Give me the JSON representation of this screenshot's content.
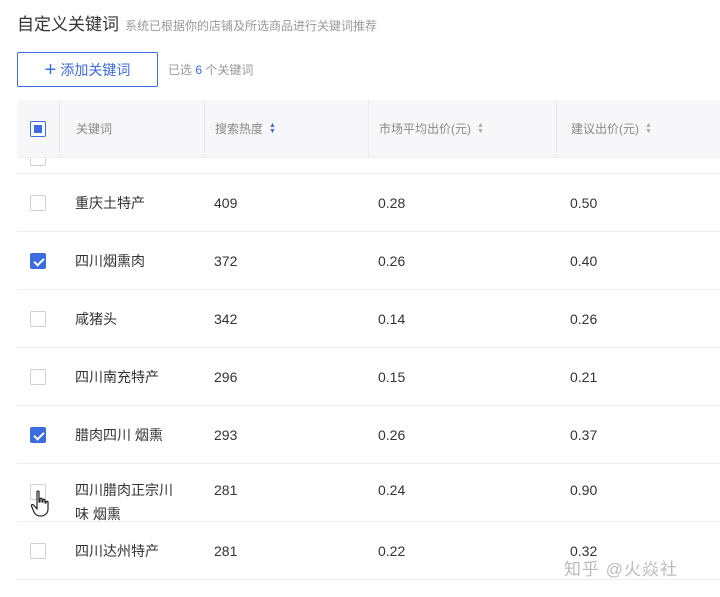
{
  "header": {
    "title": "自定义关键词",
    "subtitle": "系统已根据你的店铺及所选商品进行关键词推荐"
  },
  "toolbar": {
    "add_label": "添加关键词",
    "selected_prefix": "已选",
    "selected_count": "6",
    "selected_suffix": "个关键词"
  },
  "table": {
    "columns": {
      "keyword": "关键词",
      "heat": "搜索热度",
      "market_bid": "市场平均出价(元)",
      "suggest_bid": "建议出价(元)"
    },
    "rows": [
      {
        "keyword": "重庆土特产",
        "heat": "409",
        "market_bid": "0.28",
        "suggest_bid": "0.50",
        "checked": false
      },
      {
        "keyword": "四川烟熏肉",
        "heat": "372",
        "market_bid": "0.26",
        "suggest_bid": "0.40",
        "checked": true
      },
      {
        "keyword": "咸猪头",
        "heat": "342",
        "market_bid": "0.14",
        "suggest_bid": "0.26",
        "checked": false
      },
      {
        "keyword": "四川南充特产",
        "heat": "296",
        "market_bid": "0.15",
        "suggest_bid": "0.21",
        "checked": false
      },
      {
        "keyword": "腊肉四川 烟熏",
        "heat": "293",
        "market_bid": "0.26",
        "suggest_bid": "0.37",
        "checked": true
      },
      {
        "keyword_line1": "四川腊肉正宗川",
        "keyword_line2": "味 烟熏",
        "heat": "281",
        "market_bid": "0.24",
        "suggest_bid": "0.90",
        "checked": false
      },
      {
        "keyword": "四川达州特产",
        "heat": "281",
        "market_bid": "0.22",
        "suggest_bid": "0.32",
        "checked": false
      }
    ]
  },
  "watermark": "知乎 @火焱社",
  "colors": {
    "accent": "#3d6be0"
  }
}
